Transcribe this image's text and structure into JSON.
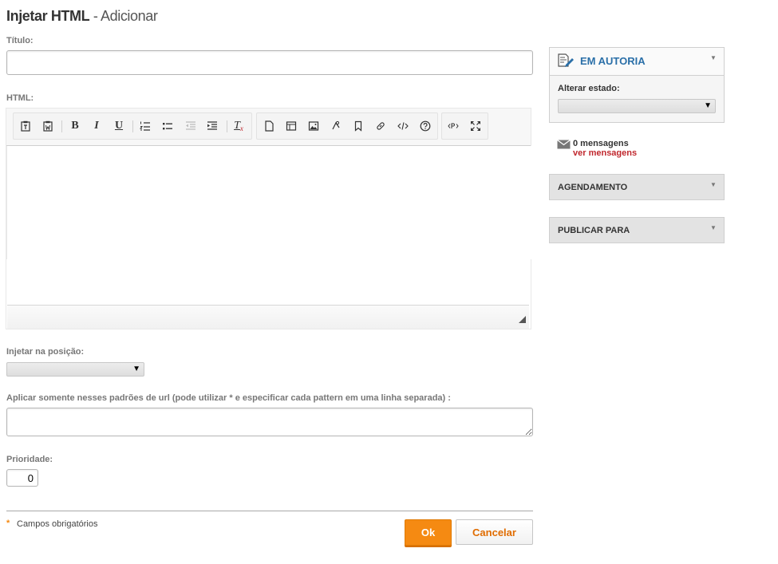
{
  "header": {
    "title_main": "Injetar HTML",
    "title_sub": "- Adicionar"
  },
  "form": {
    "title_label": "Título:",
    "title_value": "",
    "html_label": "HTML:",
    "position_label": "Injetar na posição:",
    "position_value": "",
    "url_patterns_label": "Aplicar somente nesses padrões de url (pode utilizar * e especificar cada pattern em uma linha separada) :",
    "url_patterns_value": "",
    "priority_label": "Prioridade:",
    "priority_value": "0",
    "required_note": "Campos obrigatórios",
    "required_marker": "*"
  },
  "toolbar": {
    "bold": "B",
    "italic": "I",
    "underline": "U",
    "clear_format": "T",
    "clear_format_sub": "x"
  },
  "sidebar": {
    "authoring_title": "EM AUTORIA",
    "change_state_label": "Alterar estado:",
    "state_value": "",
    "messages_count": "0 mensagens",
    "messages_link": "ver mensagens",
    "scheduling_title": "AGENDAMENTO",
    "publish_title": "PUBLICAR PARA"
  },
  "actions": {
    "ok_label": "Ok",
    "cancel_label": "Cancelar"
  },
  "colors": {
    "accent_orange": "#f58a12",
    "link_red": "#c0272d",
    "panel_title_blue": "#2a6fa8"
  }
}
